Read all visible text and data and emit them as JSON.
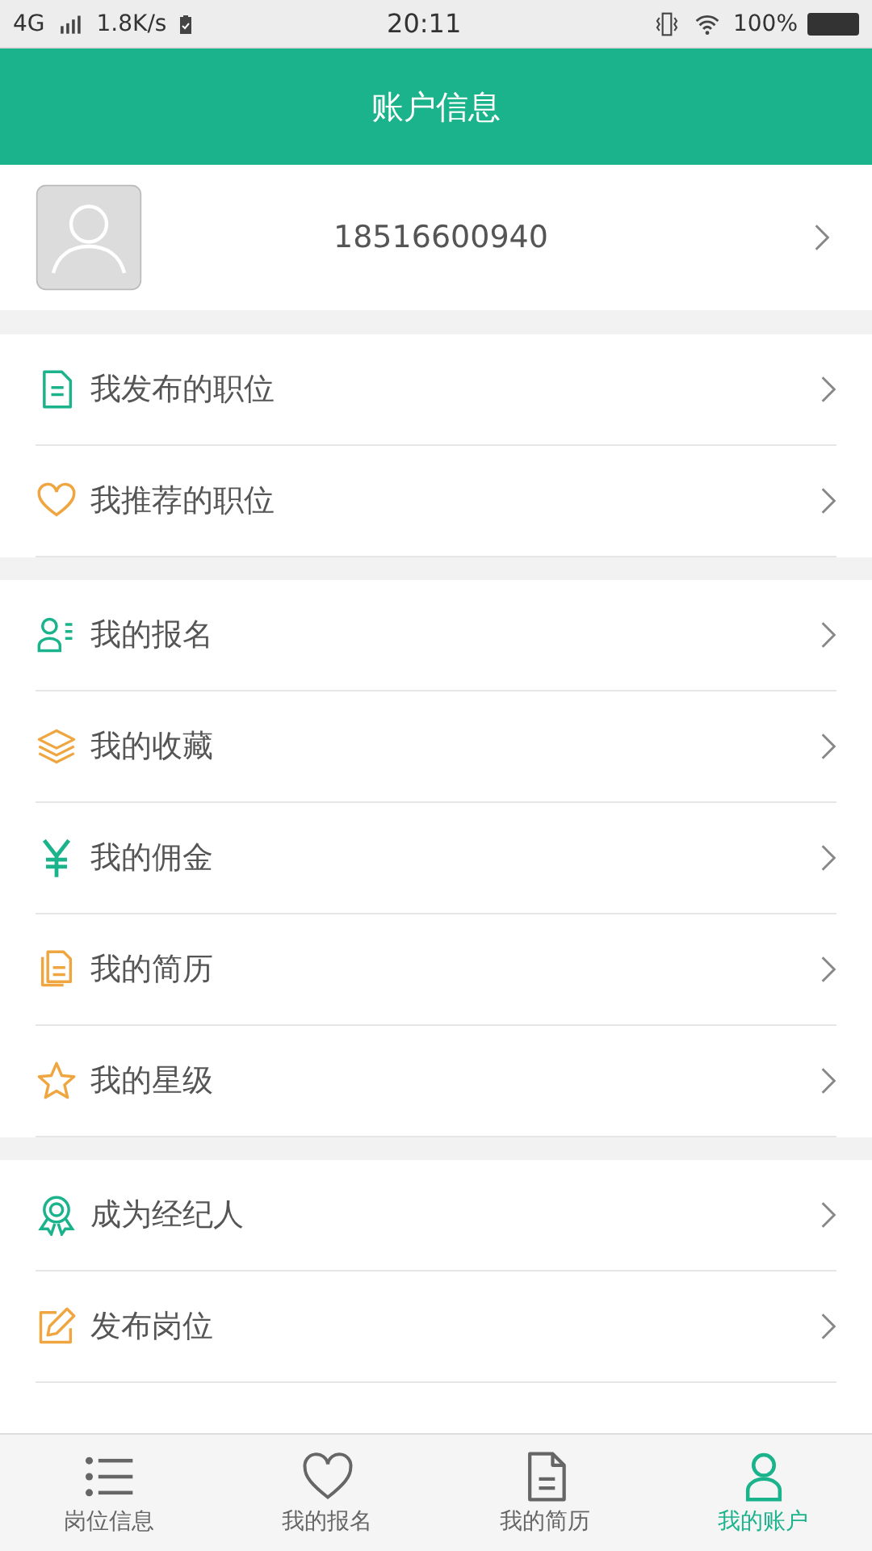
{
  "status_bar": {
    "network": "4G",
    "speed": "1.8K/s",
    "time": "20:11",
    "battery": "100%"
  },
  "header": {
    "title": "账户信息"
  },
  "profile": {
    "phone": "18516600940"
  },
  "menu_groups": [
    {
      "items": [
        {
          "label": "我发布的职位"
        },
        {
          "label": "我推荐的职位"
        }
      ]
    },
    {
      "items": [
        {
          "label": "我的报名"
        },
        {
          "label": "我的收藏"
        },
        {
          "label": "我的佣金"
        },
        {
          "label": "我的简历"
        },
        {
          "label": "我的星级"
        }
      ]
    },
    {
      "items": [
        {
          "label": "成为经纪人"
        },
        {
          "label": "发布岗位"
        }
      ]
    }
  ],
  "tab_bar": [
    {
      "label": "岗位信息",
      "selected": false
    },
    {
      "label": "我的报名",
      "selected": false
    },
    {
      "label": "我的简历",
      "selected": false
    },
    {
      "label": "我的账户",
      "selected": true
    }
  ]
}
